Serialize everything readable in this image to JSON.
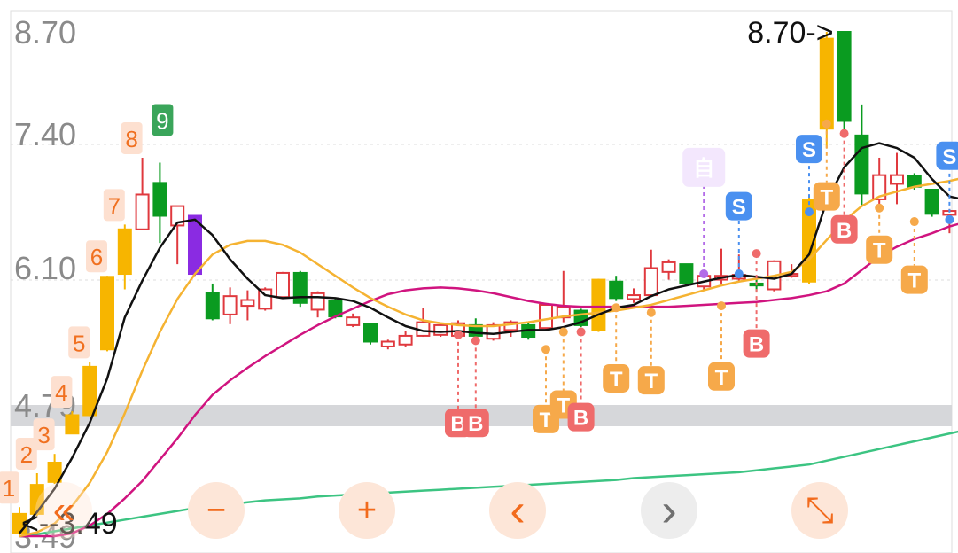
{
  "chart_data": {
    "type": "candlestick",
    "y_axis": {
      "tick_labels": [
        "8.70",
        "7.40",
        "6.10",
        "4.79",
        "3.49"
      ],
      "max": 8.7,
      "min": 3.49
    },
    "high_callout": "8.70->",
    "low_callout": "<--3.49",
    "nine_sequence": [
      "1",
      "2",
      "3",
      "4",
      "5",
      "6",
      "7",
      "8",
      "9"
    ],
    "candles": [
      {
        "o": 3.52,
        "c": 3.72,
        "h": 3.79,
        "l": 3.49,
        "color": "yellow"
      },
      {
        "o": 3.72,
        "c": 4.02,
        "h": 4.14,
        "l": 3.7,
        "color": "yellow"
      },
      {
        "o": 4.05,
        "c": 4.25,
        "h": 4.34,
        "l": 4.03,
        "color": "yellow"
      },
      {
        "o": 4.55,
        "c": 4.74,
        "h": 4.78,
        "l": 4.55,
        "color": "yellow"
      },
      {
        "o": 4.74,
        "c": 5.24,
        "h": 5.29,
        "l": 4.73,
        "color": "yellow"
      },
      {
        "o": 5.42,
        "c": 6.17,
        "h": 6.18,
        "l": 5.4,
        "color": "yellow"
      },
      {
        "o": 6.2,
        "c": 6.66,
        "h": 6.71,
        "l": 6.04,
        "color": "yellow"
      },
      {
        "o": 6.66,
        "c": 7.02,
        "h": 7.4,
        "l": 6.66,
        "color": "up"
      },
      {
        "o": 7.14,
        "c": 6.8,
        "h": 7.35,
        "l": 6.52,
        "color": "down"
      },
      {
        "o": 6.9,
        "c": 6.7,
        "h": 6.9,
        "l": 6.3,
        "color": "up"
      },
      {
        "o": 6.8,
        "c": 6.2,
        "h": 6.8,
        "l": 6.18,
        "color": "purple"
      },
      {
        "o": 6.0,
        "c": 5.74,
        "h": 6.1,
        "l": 5.72,
        "color": "down"
      },
      {
        "o": 5.78,
        "c": 5.97,
        "h": 6.06,
        "l": 5.68,
        "color": "up"
      },
      {
        "o": 5.87,
        "c": 5.93,
        "h": 6.03,
        "l": 5.72,
        "color": "up"
      },
      {
        "o": 5.84,
        "c": 6.04,
        "h": 6.06,
        "l": 5.82,
        "color": "up"
      },
      {
        "o": 5.96,
        "c": 6.21,
        "h": 6.22,
        "l": 5.95,
        "color": "up"
      },
      {
        "o": 6.21,
        "c": 5.9,
        "h": 6.23,
        "l": 5.86,
        "color": "down"
      },
      {
        "o": 6.0,
        "c": 5.83,
        "h": 6.02,
        "l": 5.75,
        "color": "up"
      },
      {
        "o": 5.92,
        "c": 5.76,
        "h": 5.95,
        "l": 5.74,
        "color": "down"
      },
      {
        "o": 5.75,
        "c": 5.67,
        "h": 5.79,
        "l": 5.65,
        "color": "up"
      },
      {
        "o": 5.68,
        "c": 5.5,
        "h": 5.68,
        "l": 5.47,
        "color": "down"
      },
      {
        "o": 5.45,
        "c": 5.5,
        "h": 5.52,
        "l": 5.42,
        "color": "up"
      },
      {
        "o": 5.47,
        "c": 5.56,
        "h": 5.61,
        "l": 5.45,
        "color": "up"
      },
      {
        "o": 5.56,
        "c": 5.7,
        "h": 5.85,
        "l": 5.55,
        "color": "up"
      },
      {
        "o": 5.57,
        "c": 5.67,
        "h": 5.69,
        "l": 5.55,
        "color": "up"
      },
      {
        "o": 5.56,
        "c": 5.69,
        "h": 5.72,
        "l": 5.54,
        "color": "up"
      },
      {
        "o": 5.67,
        "c": 5.56,
        "h": 5.74,
        "l": 5.53,
        "color": "down"
      },
      {
        "o": 5.53,
        "c": 5.67,
        "h": 5.7,
        "l": 5.51,
        "color": "up"
      },
      {
        "o": 5.62,
        "c": 5.7,
        "h": 5.72,
        "l": 5.55,
        "color": "up"
      },
      {
        "o": 5.67,
        "c": 5.55,
        "h": 5.7,
        "l": 5.52,
        "color": "down"
      },
      {
        "o": 5.64,
        "c": 5.88,
        "h": 5.9,
        "l": 5.62,
        "color": "up"
      },
      {
        "o": 5.75,
        "c": 5.86,
        "h": 6.23,
        "l": 5.7,
        "color": "up"
      },
      {
        "o": 5.82,
        "c": 5.67,
        "h": 5.84,
        "l": 5.65,
        "color": "down"
      },
      {
        "o": 5.62,
        "c": 6.14,
        "h": 6.15,
        "l": 5.6,
        "color": "yellow"
      },
      {
        "o": 6.12,
        "c": 5.95,
        "h": 6.18,
        "l": 5.92,
        "color": "down"
      },
      {
        "o": 5.94,
        "c": 5.98,
        "h": 6.05,
        "l": 5.9,
        "color": "up"
      },
      {
        "o": 5.98,
        "c": 6.26,
        "h": 6.45,
        "l": 5.98,
        "color": "up"
      },
      {
        "o": 6.22,
        "c": 6.32,
        "h": 6.35,
        "l": 6.14,
        "color": "up"
      },
      {
        "o": 6.3,
        "c": 6.1,
        "h": 6.3,
        "l": 6.08,
        "color": "down"
      },
      {
        "o": 6.07,
        "c": 6.18,
        "h": 6.24,
        "l": 6.04,
        "color": "up"
      },
      {
        "o": 6.14,
        "c": 6.18,
        "h": 6.46,
        "l": 6.1,
        "color": "up"
      },
      {
        "o": 6.15,
        "c": 6.19,
        "h": 6.4,
        "l": 6.13,
        "color": "up"
      },
      {
        "o": 6.1,
        "c": 6.08,
        "h": 6.14,
        "l": 6.02,
        "color": "down"
      },
      {
        "o": 6.04,
        "c": 6.33,
        "h": 6.34,
        "l": 6.02,
        "color": "up"
      },
      {
        "o": 6.18,
        "c": 6.2,
        "h": 6.3,
        "l": 6.16,
        "color": "up"
      },
      {
        "o": 6.12,
        "c": 6.96,
        "h": 7.0,
        "l": 6.1,
        "color": "yellow"
      },
      {
        "o": 7.7,
        "c": 8.63,
        "h": 8.7,
        "l": 7.5,
        "color": "yellow"
      },
      {
        "o": 8.7,
        "c": 7.78,
        "h": 8.7,
        "l": 7.68,
        "color": "down"
      },
      {
        "o": 7.63,
        "c": 7.03,
        "h": 7.95,
        "l": 6.9,
        "color": "down"
      },
      {
        "o": 6.97,
        "c": 7.22,
        "h": 7.4,
        "l": 6.86,
        "color": "up"
      },
      {
        "o": 7.13,
        "c": 7.22,
        "h": 7.45,
        "l": 6.92,
        "color": "up"
      },
      {
        "o": 7.21,
        "c": 7.1,
        "h": 7.24,
        "l": 7.07,
        "color": "down"
      },
      {
        "o": 7.07,
        "c": 6.82,
        "h": 7.07,
        "l": 6.79,
        "color": "down"
      },
      {
        "o": 6.81,
        "c": 6.85,
        "h": 6.87,
        "l": 6.62,
        "color": "up"
      }
    ],
    "ma_black": [
      3.52,
      3.74,
      3.98,
      4.3,
      4.66,
      5.12,
      5.75,
      6.13,
      6.47,
      6.73,
      6.76,
      6.6,
      6.35,
      6.15,
      5.98,
      5.95,
      5.96,
      5.96,
      5.95,
      5.92,
      5.85,
      5.75,
      5.66,
      5.61,
      5.6,
      5.61,
      5.59,
      5.58,
      5.6,
      5.62,
      5.62,
      5.65,
      5.7,
      5.78,
      5.85,
      5.88,
      5.97,
      6.04,
      6.08,
      6.12,
      6.16,
      6.19,
      6.17,
      6.15,
      6.2,
      6.4,
      6.95,
      7.3,
      7.5,
      7.55,
      7.5,
      7.4,
      7.18,
      7.0,
      6.96
    ],
    "ma_orange": [
      3.49,
      3.53,
      3.62,
      3.8,
      4.04,
      4.36,
      4.76,
      5.2,
      5.6,
      5.94,
      6.2,
      6.4,
      6.5,
      6.54,
      6.54,
      6.5,
      6.42,
      6.3,
      6.18,
      6.06,
      5.95,
      5.86,
      5.78,
      5.72,
      5.69,
      5.67,
      5.66,
      5.66,
      5.68,
      5.7,
      5.73,
      5.76,
      5.78,
      5.8,
      5.82,
      5.85,
      5.88,
      5.93,
      5.98,
      6.03,
      6.08,
      6.12,
      6.15,
      6.18,
      6.22,
      6.35,
      6.55,
      6.75,
      6.9,
      7.0,
      7.05,
      7.1,
      7.13,
      7.16,
      7.2
    ],
    "ma_magenta": [
      3.49,
      3.49,
      3.49,
      3.52,
      3.6,
      3.72,
      3.88,
      4.06,
      4.28,
      4.5,
      4.74,
      4.95,
      5.1,
      5.23,
      5.35,
      5.46,
      5.57,
      5.67,
      5.76,
      5.84,
      5.92,
      5.99,
      6.03,
      6.05,
      6.06,
      6.05,
      6.03,
      6.0,
      5.96,
      5.92,
      5.89,
      5.87,
      5.86,
      5.86,
      5.86,
      5.86,
      5.86,
      5.86,
      5.87,
      5.88,
      5.89,
      5.9,
      5.91,
      5.93,
      5.95,
      5.98,
      6.02,
      6.1,
      6.24,
      6.38,
      6.48,
      6.56,
      6.62,
      6.69,
      6.74
    ],
    "ma_green": [
      3.49,
      3.51,
      3.54,
      3.57,
      3.6,
      3.63,
      3.66,
      3.69,
      3.72,
      3.75,
      3.78,
      3.8,
      3.82,
      3.84,
      3.86,
      3.87,
      3.88,
      3.9,
      3.91,
      3.92,
      3.93,
      3.94,
      3.95,
      3.96,
      3.97,
      3.98,
      3.99,
      4.0,
      4.01,
      4.02,
      4.03,
      4.04,
      4.05,
      4.06,
      4.07,
      4.09,
      4.1,
      4.11,
      4.12,
      4.13,
      4.14,
      4.15,
      4.17,
      4.19,
      4.21,
      4.23,
      4.27,
      4.31,
      4.35,
      4.39,
      4.43,
      4.47,
      4.51,
      4.55,
      4.59
    ],
    "signals": [
      {
        "i": 25,
        "text": "B",
        "kind": "buy",
        "dot": 5.57,
        "label": 4.66
      },
      {
        "i": 26,
        "text": "B",
        "kind": "buy",
        "dot": 5.51,
        "label": 4.66
      },
      {
        "i": 30,
        "text": "T",
        "kind": "tip",
        "dot": 5.42,
        "label": 4.7
      },
      {
        "i": 31,
        "text": "T",
        "kind": "tip",
        "dot": 5.6,
        "label": 4.85
      },
      {
        "i": 32,
        "text": "B",
        "kind": "buy",
        "dot": 5.6,
        "label": 4.72
      },
      {
        "i": 34,
        "text": "T",
        "kind": "tip",
        "dot": 5.85,
        "label": 5.12
      },
      {
        "i": 36,
        "text": "T",
        "kind": "tip",
        "dot": 5.8,
        "label": 5.1
      },
      {
        "i": 40,
        "text": "T",
        "kind": "tip",
        "dot": 5.87,
        "label": 5.14
      },
      {
        "i": 42,
        "text": "B",
        "kind": "buy",
        "dot": 6.41,
        "label": 5.48
      },
      {
        "i": 46,
        "text": "T",
        "kind": "tip",
        "dot": 7.75,
        "label": 7.0
      },
      {
        "i": 47,
        "text": "B",
        "kind": "buy",
        "dot": 7.65,
        "label": 6.66
      },
      {
        "i": 49,
        "text": "T",
        "kind": "tip",
        "dot": 6.88,
        "label": 6.45
      },
      {
        "i": 51,
        "text": "T",
        "kind": "tip",
        "dot": 6.74,
        "label": 6.14
      },
      {
        "i": 41,
        "text": "S",
        "kind": "sell",
        "dot": 6.2,
        "label": 6.9
      },
      {
        "i": 45,
        "text": "S",
        "kind": "sell",
        "dot": 6.84,
        "label": 7.49
      },
      {
        "i": 53,
        "text": "S",
        "kind": "sell",
        "dot": 6.76,
        "label": 7.42
      },
      {
        "i": 39,
        "text": "自",
        "kind": "self",
        "dot": 6.2,
        "label": 7.3
      }
    ]
  },
  "controls": {
    "back_double_icon": "«",
    "zoom_out_icon": "−",
    "zoom_in_icon": "+",
    "prev_icon": "‹",
    "next_icon": "›",
    "expand_icon": "⤡"
  },
  "colors": {
    "up": "#e0393e",
    "down": "#0a9b20",
    "yellow": "#f7b500",
    "purple": "#8a2be2",
    "ma_black": "#111111",
    "ma_orange": "#f5b332",
    "ma_magenta": "#d0147f",
    "ma_green": "#3cc482",
    "buy": "#ef6b6b",
    "tip": "#f6a94a",
    "sell": "#4a90f0",
    "self": "#b36ce8"
  }
}
